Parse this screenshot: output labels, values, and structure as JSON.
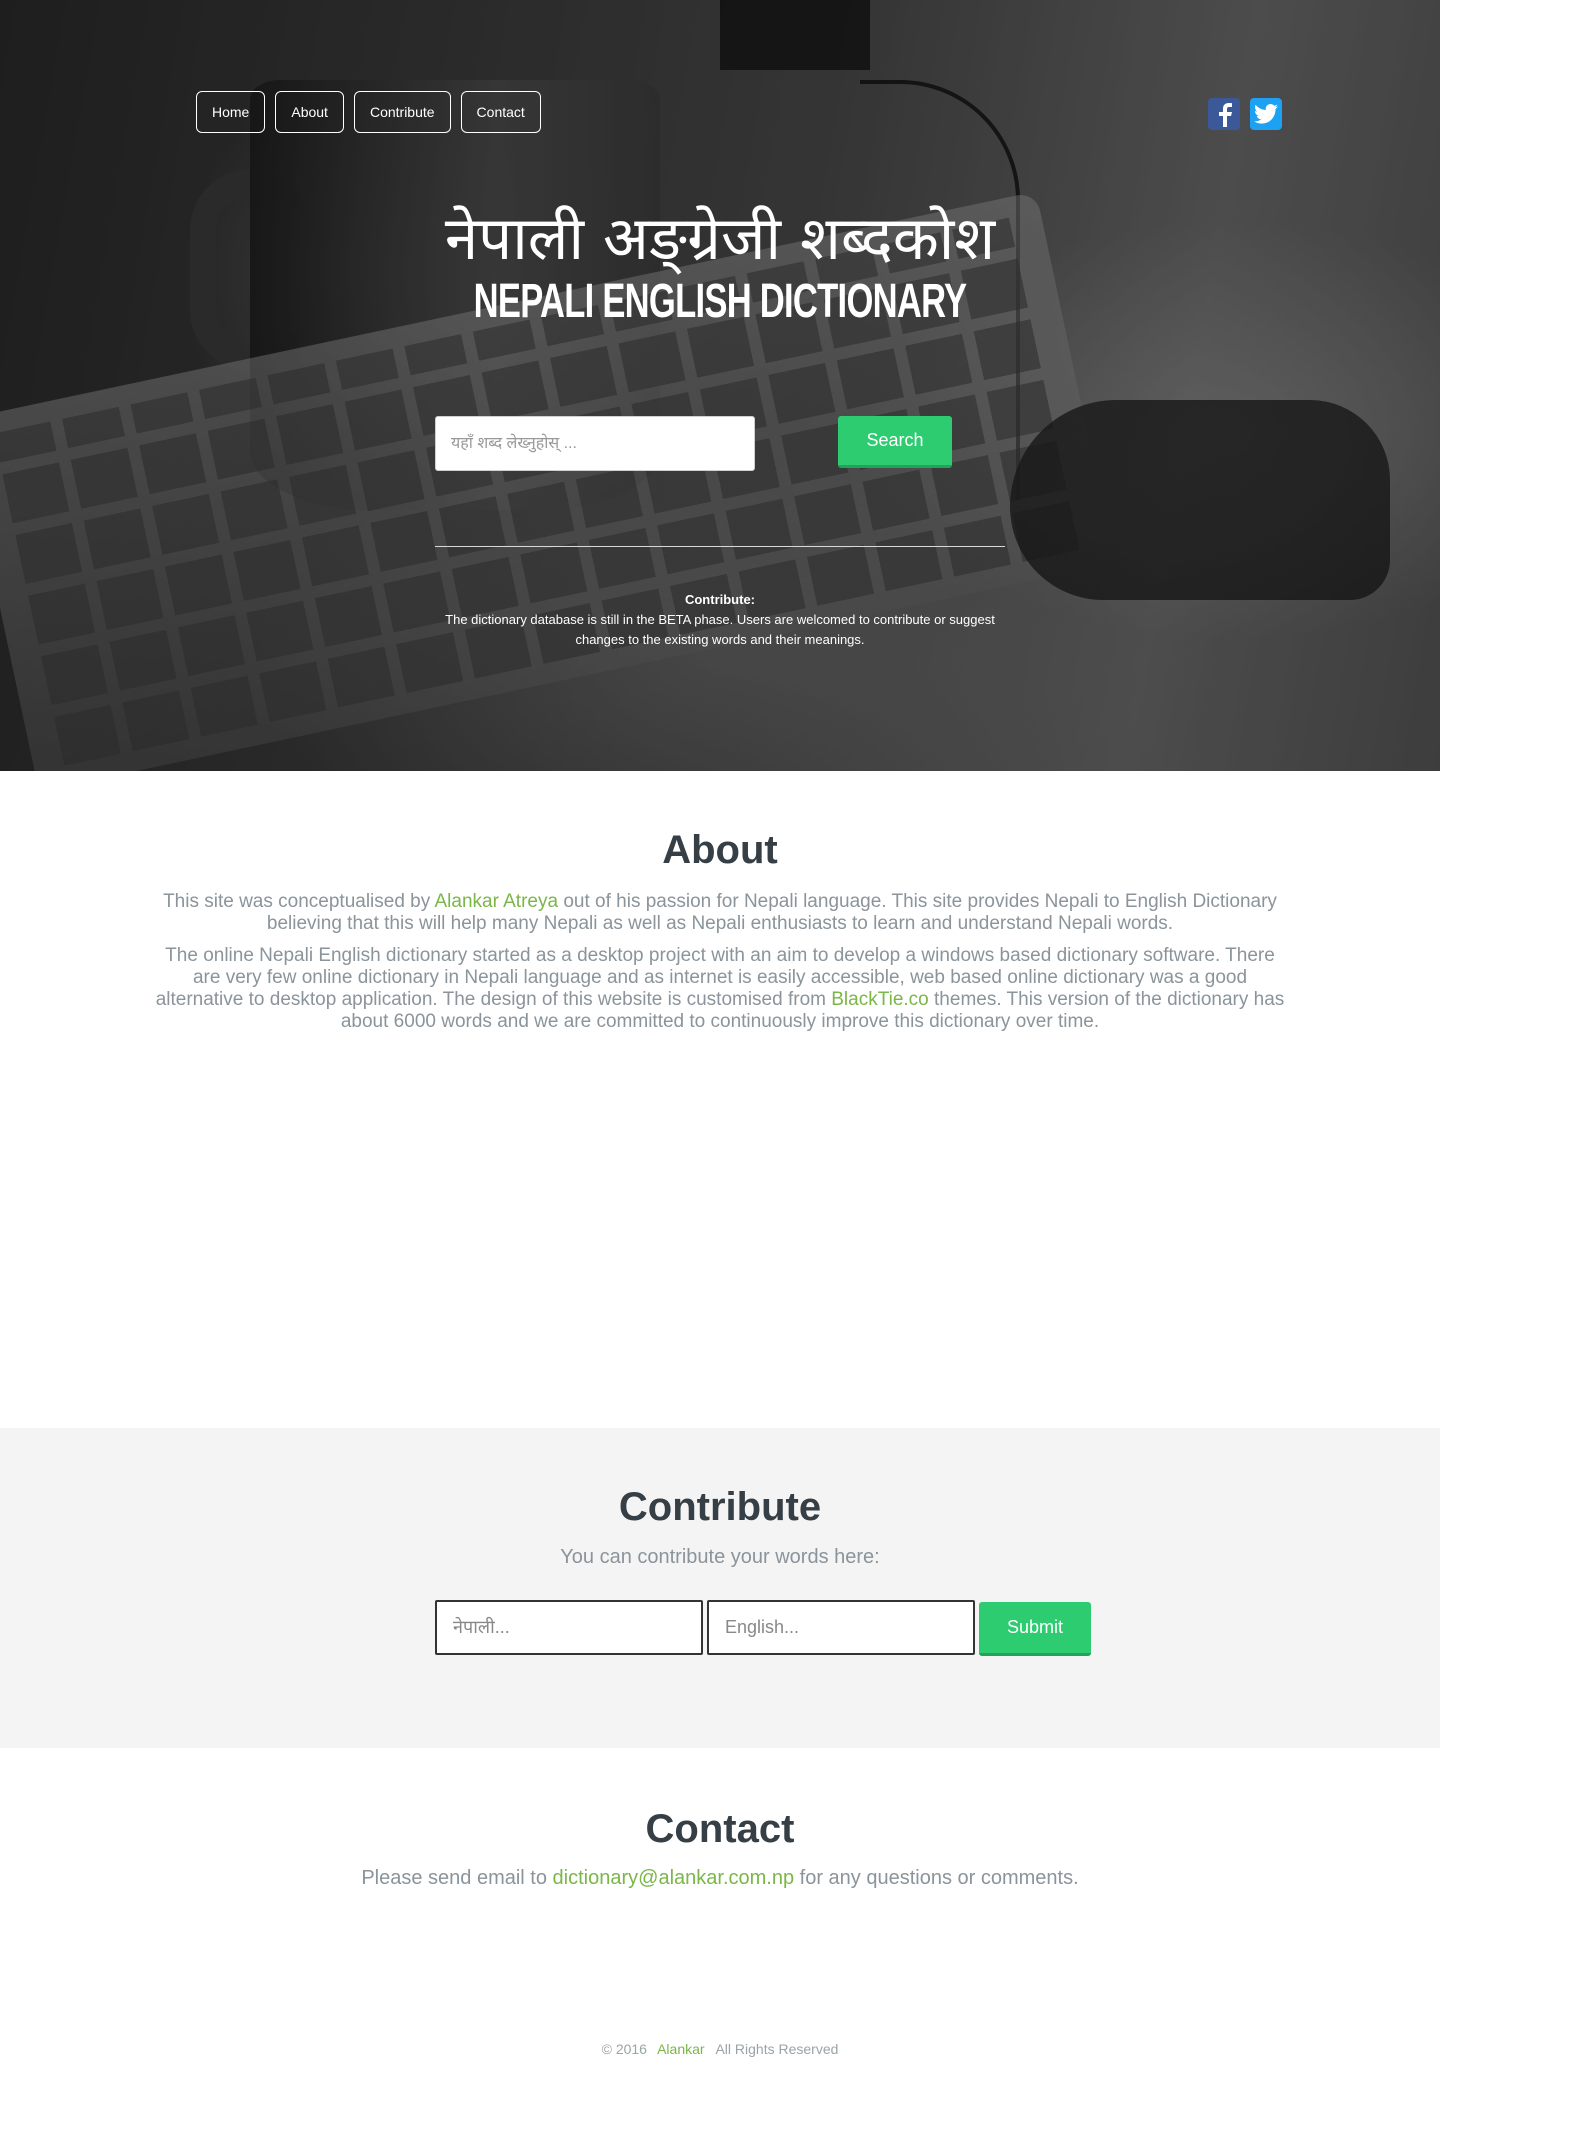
{
  "nav": {
    "items": [
      {
        "label": "Home"
      },
      {
        "label": "About"
      },
      {
        "label": "Contribute"
      },
      {
        "label": "Contact"
      }
    ]
  },
  "social": {
    "facebook_icon": "facebook-icon",
    "twitter_icon": "twitter-icon",
    "colors": {
      "facebook": "#3b5998",
      "twitter": "#1da1f2"
    }
  },
  "hero": {
    "title_nepali": "नेपाली अङ्ग्रेजी शब्दकोश",
    "title_english": "NEPALI ENGLISH DICTIONARY",
    "search": {
      "placeholder": "यहाँ शब्द लेख्नुहोस् ...",
      "value": "",
      "button_label": "Search"
    },
    "note": {
      "heading": "Contribute:",
      "text": "The dictionary database is still in the BETA phase. Users are welcomed to contribute or suggest changes to the existing words and their meanings."
    }
  },
  "about": {
    "title": "About",
    "p1_before": "This site was conceptualised by ",
    "p1_link": "Alankar Atreya",
    "p1_after": " out of his passion for Nepali language. This site provides Nepali to English Dictionary believing that this will help many Nepali as well as Nepali enthusiasts to learn and understand Nepali words.",
    "p2_before": "The online Nepali English dictionary started as a desktop project with an aim to develop a windows based dictionary software. There are very few online dictionary in Nepali language and as internet is easily accessible, web based online dictionary was a good alternative to desktop application. The design of this website is customised from ",
    "p2_link": "BlackTie.co",
    "p2_after": " themes. This version of the dictionary has about 6000 words and we are committed to continuously improve this dictionary over time."
  },
  "contribute": {
    "title": "Contribute",
    "subtitle": "You can contribute your words here:",
    "nepali_placeholder": "नेपाली...",
    "english_placeholder": "English...",
    "submit_label": "Submit"
  },
  "contact": {
    "title": "Contact",
    "text_before": "Please send email to ",
    "email": "dictionary@alankar.com.np",
    "text_after": " for any questions or comments."
  },
  "footer": {
    "copyright": "© 2016",
    "author": "Alankar",
    "rights": "All Rights Reserved"
  },
  "colors": {
    "accent_green": "#2ecc71",
    "link_green": "#7ab648",
    "heading": "#353f45",
    "body_text": "#8a949a"
  }
}
